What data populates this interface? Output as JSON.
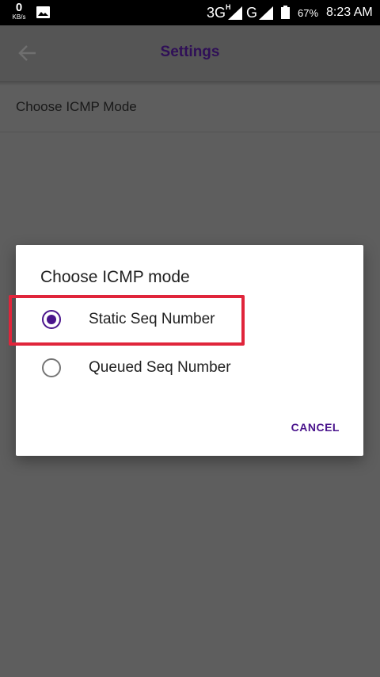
{
  "status_bar": {
    "data_speed": "0",
    "data_speed_unit": "KB/s",
    "network_1": "3G",
    "network_1_badge": "H",
    "network_2": "G",
    "battery_percent": "67%",
    "time": "8:23 AM"
  },
  "app_bar": {
    "title": "Settings",
    "back_icon": "arrow-left-icon"
  },
  "preference": {
    "label": "Choose ICMP Mode"
  },
  "dialog": {
    "title": "Choose ICMP mode",
    "options": [
      {
        "label": "Static Seq Number",
        "selected": true
      },
      {
        "label": "Queued Seq Number",
        "selected": false
      }
    ],
    "cancel_label": "CANCEL"
  },
  "colors": {
    "accent": "#4a148c",
    "highlight": "#e0253b",
    "scrim": "#5e5e5e"
  }
}
